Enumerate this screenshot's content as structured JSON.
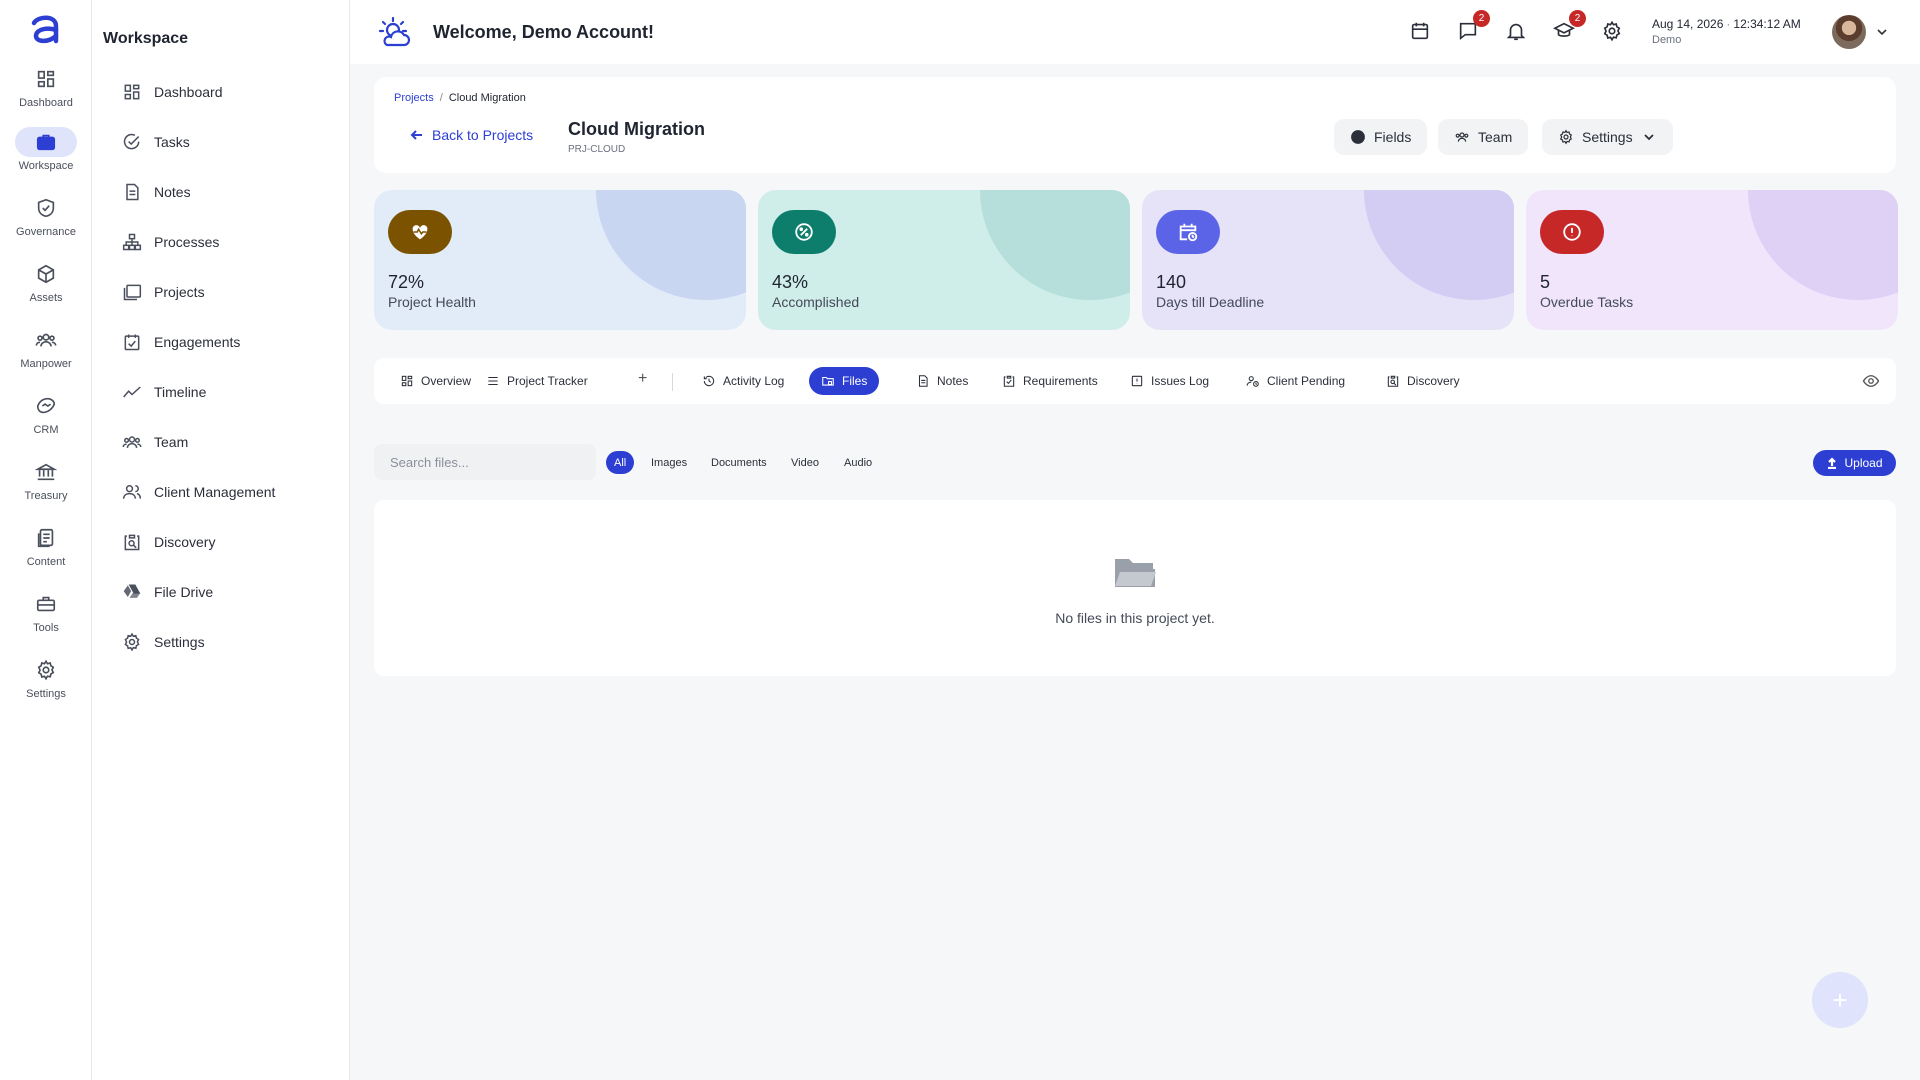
{
  "rail": {
    "items": [
      {
        "label": "Dashboard",
        "icon": "grid-icon"
      },
      {
        "label": "Workspace",
        "icon": "briefcase-icon"
      },
      {
        "label": "Governance",
        "icon": "shield-check-icon"
      },
      {
        "label": "Assets",
        "icon": "cube-icon"
      },
      {
        "label": "Manpower",
        "icon": "people-icon"
      },
      {
        "label": "CRM",
        "icon": "handshake-icon"
      },
      {
        "label": "Treasury",
        "icon": "bank-icon"
      },
      {
        "label": "Content",
        "icon": "document-icon"
      },
      {
        "label": "Tools",
        "icon": "toolbox-icon"
      },
      {
        "label": "Settings",
        "icon": "gear-icon"
      }
    ]
  },
  "sidebar": {
    "title": "Workspace",
    "items": [
      {
        "label": "Dashboard"
      },
      {
        "label": "Tasks"
      },
      {
        "label": "Notes"
      },
      {
        "label": "Processes"
      },
      {
        "label": "Projects"
      },
      {
        "label": "Engagements"
      },
      {
        "label": "Timeline"
      },
      {
        "label": "Team"
      },
      {
        "label": "Client Management"
      },
      {
        "label": "Discovery"
      },
      {
        "label": "File Drive"
      },
      {
        "label": "Settings"
      }
    ]
  },
  "topbar": {
    "welcome": "Welcome, Demo Account!",
    "messages_badge": "2",
    "courses_badge": "2",
    "date": "Aug 14, 2026",
    "time": "12:34:12 AM",
    "user": "Demo"
  },
  "header": {
    "breadcrumb_root": "Projects",
    "breadcrumb_sep": "/",
    "breadcrumb_current": "Cloud Migration",
    "back_label": "Back to Projects",
    "title": "Cloud Migration",
    "code": "PRJ-CLOUD",
    "fields_label": "Fields",
    "team_label": "Team",
    "settings_label": "Settings"
  },
  "stats": [
    {
      "value": "72%",
      "label": "Project Health",
      "bg": "#e2ecf8",
      "deco": "#c9d6f2",
      "badge": "#7a5200"
    },
    {
      "value": "43%",
      "label": "Accomplished",
      "bg": "#cfeee9",
      "deco": "#b6dedb",
      "badge": "#0d7d6c"
    },
    {
      "value": "140",
      "label": "Days till Deadline",
      "bg": "#e6e2f8",
      "deco": "#d3cdf3",
      "badge": "#5b64e6"
    },
    {
      "value": "5",
      "label": "Overdue Tasks",
      "bg": "#f1e5fb",
      "deco": "#dfd1f6",
      "badge": "#c62828"
    }
  ],
  "tabs": {
    "items": [
      {
        "label": "Overview"
      },
      {
        "label": "Project Tracker"
      },
      {
        "label": "Activity Log"
      },
      {
        "label": "Files"
      },
      {
        "label": "Notes"
      },
      {
        "label": "Requirements"
      },
      {
        "label": "Issues Log"
      },
      {
        "label": "Client Pending"
      },
      {
        "label": "Discovery"
      }
    ],
    "active": "Files",
    "add_label": "+"
  },
  "files": {
    "search_placeholder": "Search files...",
    "filters": [
      "All",
      "Images",
      "Documents",
      "Video",
      "Audio"
    ],
    "active_filter": "All",
    "upload_label": "Upload",
    "empty_message": "No files in this project yet."
  },
  "fab_label": "+",
  "colors": {
    "accent": "#2d3fd3",
    "danger": "#c62828"
  }
}
